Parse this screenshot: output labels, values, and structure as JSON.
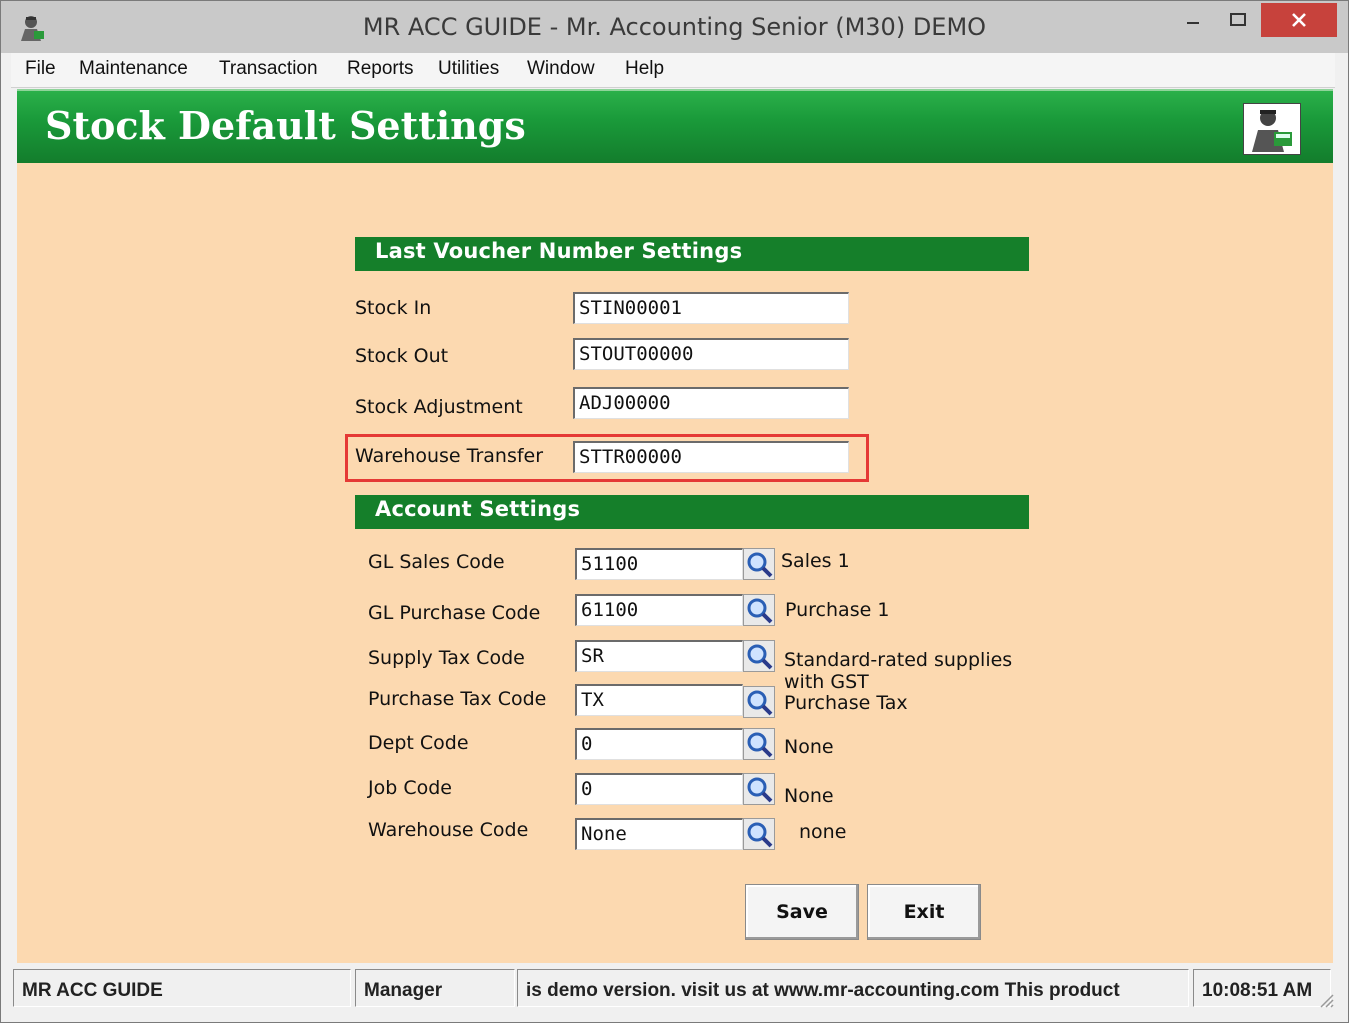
{
  "window": {
    "title": "MR ACC GUIDE - Mr. Accounting Senior (M30) DEMO",
    "app_icon": "accountant-figure-icon",
    "controls": {
      "minimize": "minimize-icon",
      "maximize": "maximize-icon",
      "close": "close-icon"
    }
  },
  "menu": {
    "items": [
      "File",
      "Maintenance",
      "Transaction",
      "Reports",
      "Utilities",
      "Window",
      "Help"
    ]
  },
  "header": {
    "title": "Stock Default Settings",
    "logo": "accountant-logo-icon",
    "color": "#1a9a3a"
  },
  "voucher_section": {
    "title": "Last Voucher Number Settings",
    "fields": [
      {
        "label": "Stock In",
        "value": "STIN00001"
      },
      {
        "label": "Stock Out",
        "value": "STOUT00000"
      },
      {
        "label": "Stock Adjustment",
        "value": "ADJ00000"
      },
      {
        "label": "Warehouse Transfer",
        "value": "STTR00000"
      }
    ]
  },
  "account_section": {
    "title": "Account Settings",
    "fields": [
      {
        "label": "GL Sales Code",
        "value": "51100",
        "desc": "Sales 1"
      },
      {
        "label": "GL Purchase Code",
        "value": "61100",
        "desc": "Purchase 1"
      },
      {
        "label": "Supply Tax Code",
        "value": "SR",
        "desc": "Standard-rated supplies with GST"
      },
      {
        "label": "Purchase Tax Code",
        "value": "TX",
        "desc": "Purchase Tax"
      },
      {
        "label": "Dept Code",
        "value": "0",
        "desc": "None"
      },
      {
        "label": "Job Code",
        "value": "0",
        "desc": "None"
      },
      {
        "label": "Warehouse Code",
        "value": "None",
        "desc": "none"
      }
    ],
    "lookup_icon": "magnifier-icon"
  },
  "buttons": {
    "save": "Save",
    "exit": "Exit"
  },
  "status": {
    "company": "MR ACC GUIDE",
    "user": "Manager",
    "message": "is demo version.  visit us at www.mr-accounting.com This product",
    "time": "10:08:51 AM"
  },
  "colors": {
    "section_green": "#157f2a",
    "background_peach": "#fcd9b0",
    "highlight_red": "#e53935",
    "close_red": "#c7423c"
  }
}
